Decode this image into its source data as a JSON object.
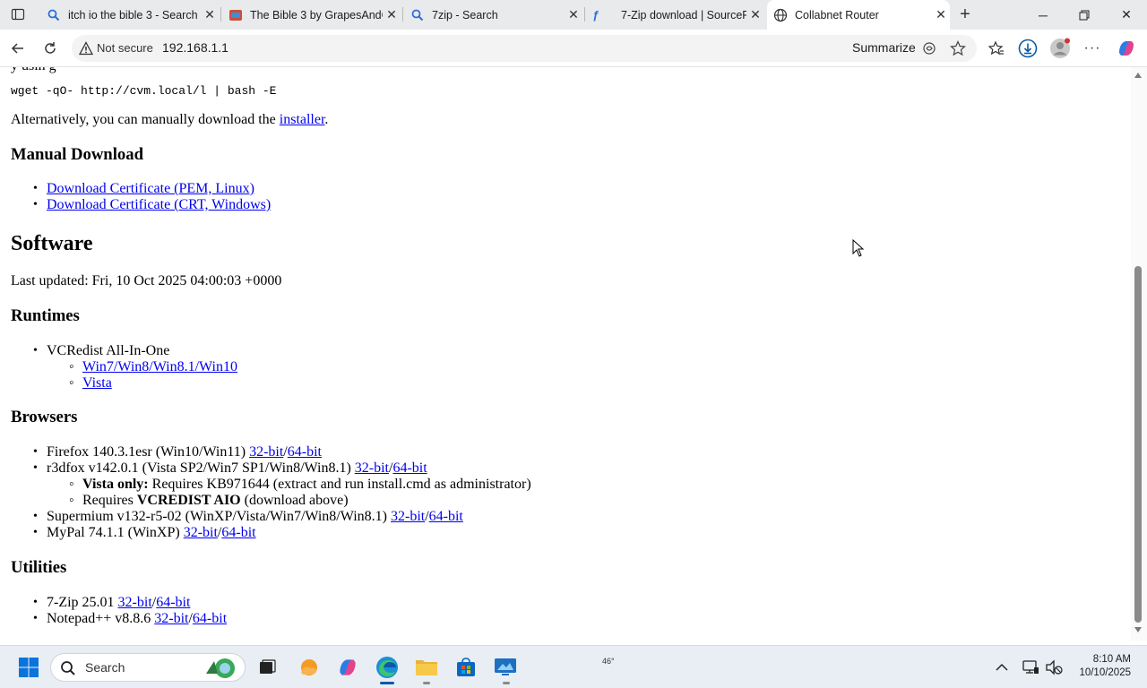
{
  "browser": {
    "tabs": [
      {
        "title": "itch io the bible 3 - Search",
        "icon": "search-icon"
      },
      {
        "title": "The Bible 3 by GrapesAndG",
        "icon": "itch-icon"
      },
      {
        "title": "7zip - Search",
        "icon": "search-icon"
      },
      {
        "title": "7-Zip download | SourceFo",
        "icon": "sourceforge-icon"
      },
      {
        "title": "Collabnet Router",
        "icon": "globe-icon",
        "active": true
      }
    ],
    "address": {
      "security_label": "Not secure",
      "url": "192.168.1.1"
    },
    "summarize_label": "Summarize"
  },
  "page": {
    "install_command": "wget -qO- http://cvm.local/l | bash -E",
    "alternative_prefix": "Alternatively, you can manually download the ",
    "installer_link": "installer",
    "alternative_suffix": ".",
    "manual_download_heading": "Manual Download",
    "cert_links": [
      "Download Certificate (PEM, Linux)",
      "Download Certificate (CRT, Windows)"
    ],
    "software_heading": "Software",
    "last_updated": "Last updated: Fri, 10 Oct 2025 04:00:03 +0000",
    "runtimes_heading": "Runtimes",
    "runtimes": {
      "vcredist": "VCRedist All-In-One",
      "links": [
        "Win7/Win8/Win8.1/Win10",
        "Vista"
      ]
    },
    "browsers_heading": "Browsers",
    "browsers": [
      {
        "name": "Firefox 140.3.1esr (Win10/Win11) ",
        "link32": "32-bit",
        "sep": "/",
        "link64": "64-bit"
      },
      {
        "name": "r3dfox v142.0.1 (Vista SP2/Win7 SP1/Win8/Win8.1) ",
        "link32": "32-bit",
        "sep": "/",
        "link64": "64-bit"
      },
      {
        "name": "Supermium v132-r5-02 (WinXP/Vista/Win7/Win8/Win8.1) ",
        "link32": "32-bit",
        "sep": "/",
        "link64": "64-bit"
      },
      {
        "name": "MyPal 74.1.1 (WinXP) ",
        "link32": "32-bit",
        "sep": "/",
        "link64": "64-bit"
      }
    ],
    "r3dfox_notes": {
      "vista_bold": "Vista only:",
      "vista_text": " Requires KB971644 (extract and run install.cmd as administrator)",
      "requires_prefix": "Requires ",
      "requires_bold": "VCREDIST AIO",
      "requires_suffix": " (download above)"
    },
    "utilities_heading": "Utilities",
    "utilities": [
      {
        "name": "7-Zip 25.01 ",
        "link32": "32-bit",
        "sep": "/",
        "link64": "64-bit"
      },
      {
        "name": "Notepad++ v8.8.6 ",
        "link32": "32-bit",
        "sep": "/",
        "link64": "64-bit"
      }
    ]
  },
  "taskbar": {
    "search_label": "Search",
    "weather_temp": "46°",
    "time": "8:10 AM",
    "date": "10/10/2025"
  },
  "colors": {
    "link": "#0000ee",
    "tabstrip_bg": "#e9eaec",
    "edge_accent": "#0c59a4"
  }
}
